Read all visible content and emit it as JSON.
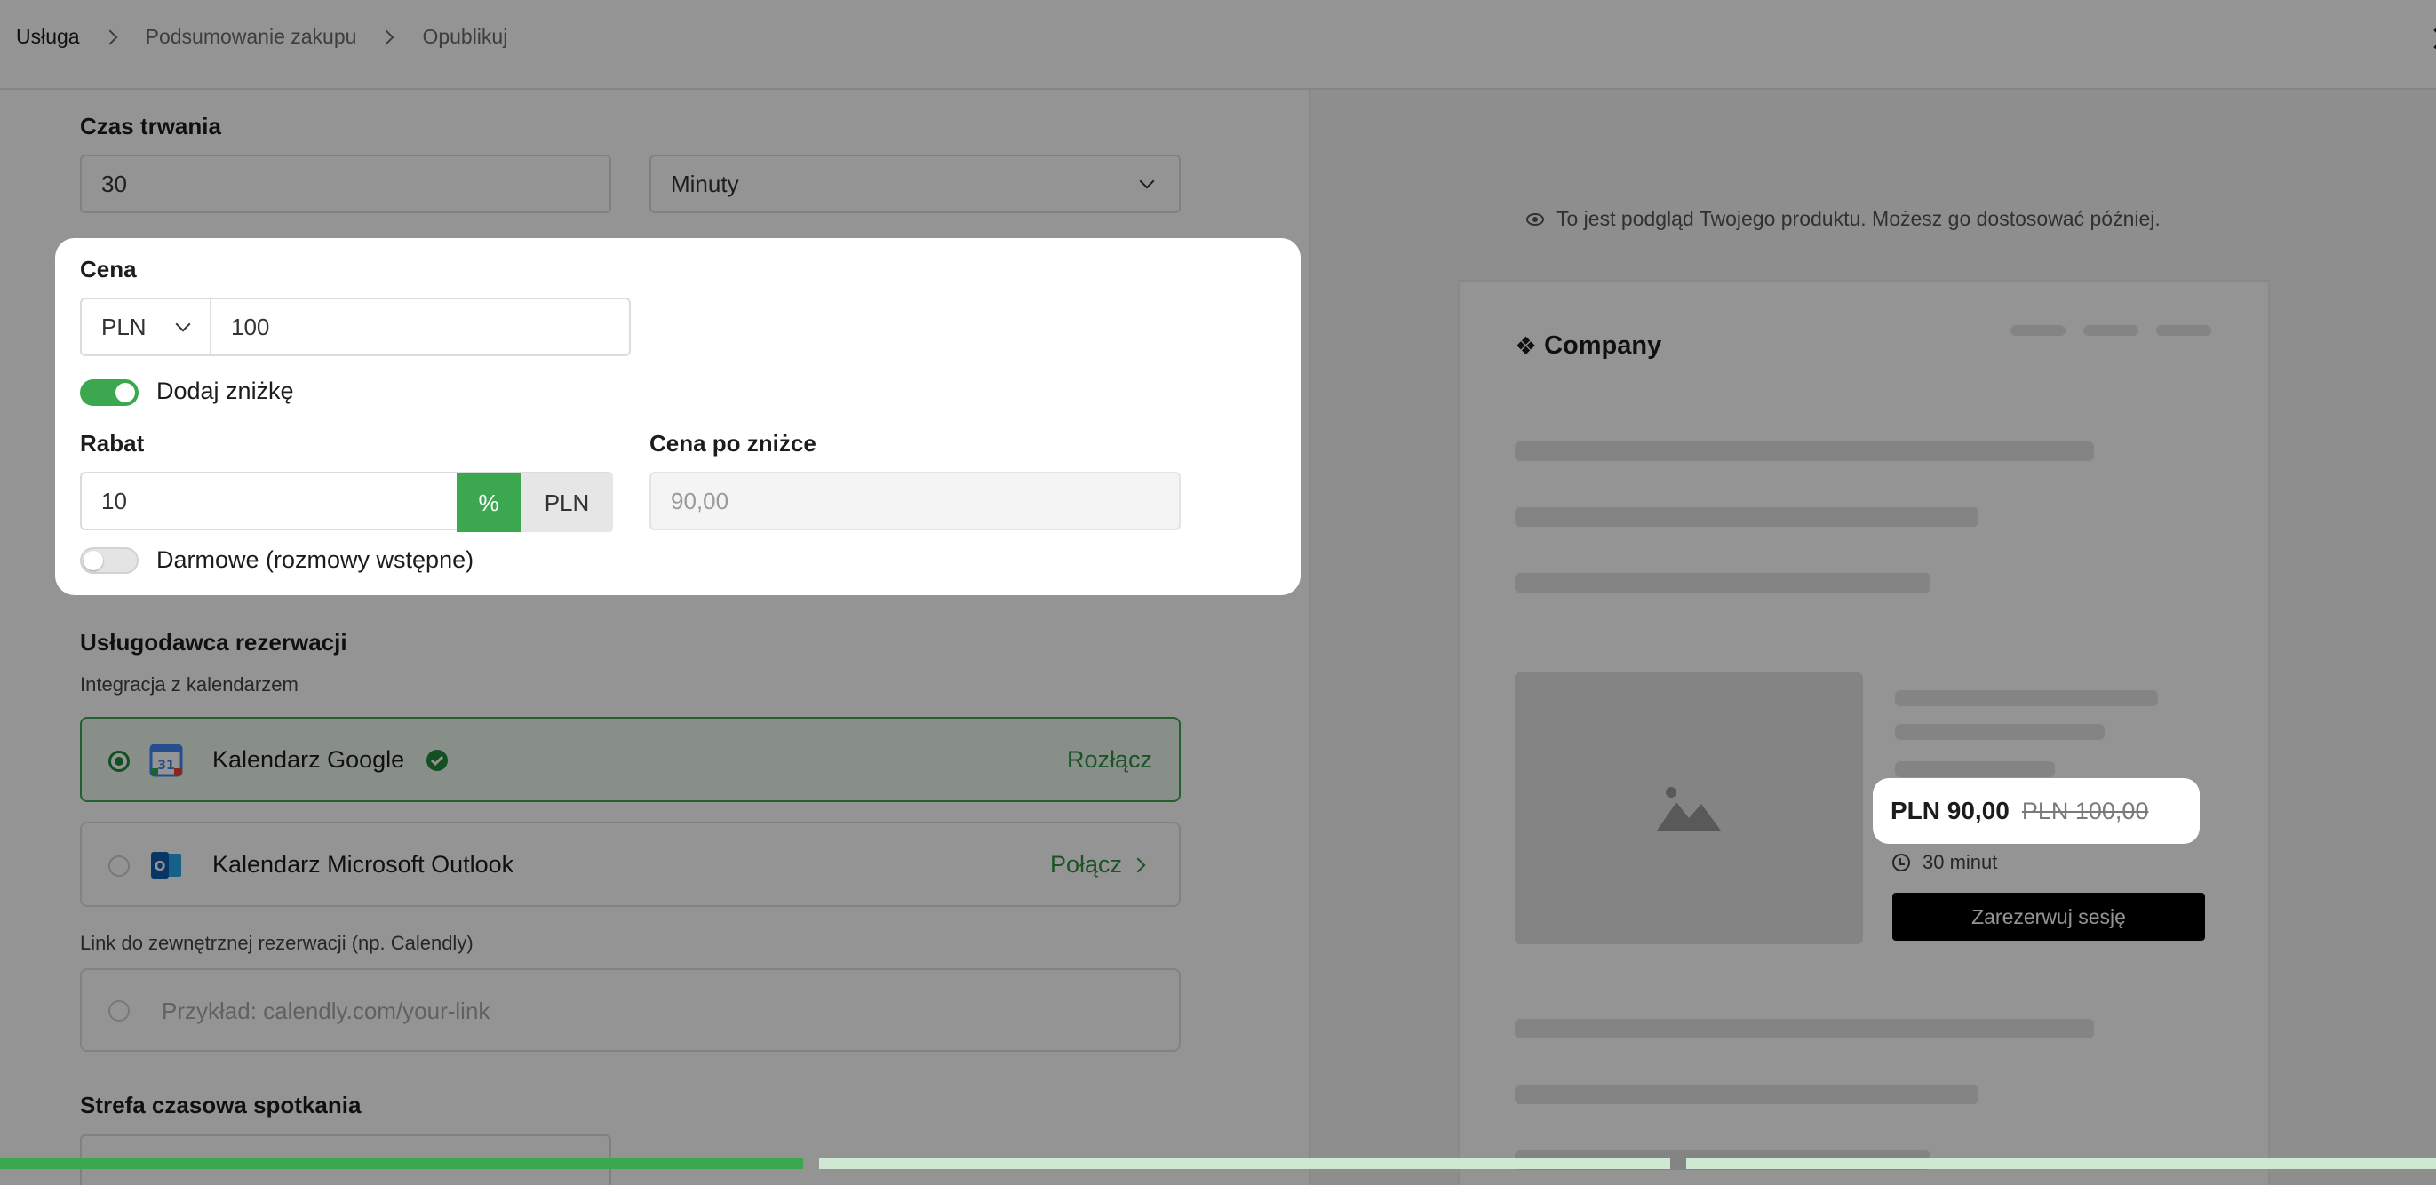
{
  "breadcrumb": {
    "items": [
      "Usługa",
      "Podsumowanie zakupu",
      "Opublikuj"
    ]
  },
  "duration": {
    "label": "Czas trwania",
    "value": "30",
    "unit": "Minuty"
  },
  "price": {
    "label": "Cena",
    "currency": "PLN",
    "value": "100",
    "discount_toggle_label": "Dodaj zniżkę",
    "discount_enabled": true,
    "discount_label": "Rabat",
    "discount_value": "10",
    "discount_type_percent": "%",
    "discount_type_currency": "PLN",
    "after_discount_label": "Cena po zniżce",
    "after_discount_value": "90,00",
    "free_toggle_label": "Darmowe (rozmowy wstępne)",
    "free_enabled": false
  },
  "booking": {
    "label": "Usługodawca rezerwacji",
    "calendar_label": "Integracja z kalendarzem",
    "google": {
      "name": "Kalendarz Google",
      "action": "Rozłącz"
    },
    "outlook": {
      "name": "Kalendarz Microsoft Outlook",
      "action": "Połącz"
    },
    "external_label": "Link do zewnętrznej rezerwacji (np. Calendly)",
    "external_placeholder": "Przykład: calendly.com/your-link"
  },
  "timezone": {
    "label": "Strefa czasowa spotkania"
  },
  "preview": {
    "note": "To jest podgląd Twojego produktu. Możesz go dostosować później.",
    "company": "Company",
    "price_new": "PLN 90,00",
    "price_old": "PLN 100,00",
    "duration": "30 minut",
    "book_button": "Zarezerwuj sesję"
  },
  "colors": {
    "accent": "#3ba84f",
    "accent_dark": "#2d8f43"
  },
  "progress": {
    "step": 1,
    "total": 3
  }
}
